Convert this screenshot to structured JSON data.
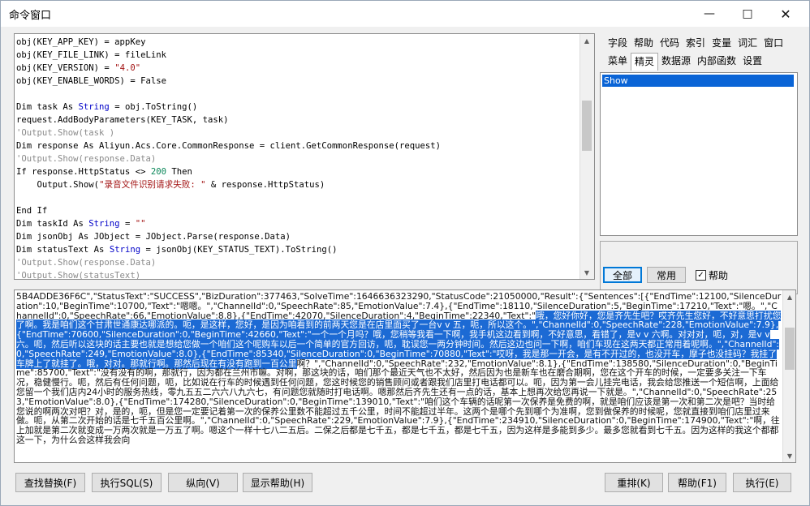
{
  "window": {
    "title": "命令窗口",
    "minimize_icon": "minimize-icon",
    "maximize_icon": "maximize-icon",
    "close_icon": "close-icon"
  },
  "code": {
    "lines": [
      [
        {
          "t": "obj(KEY_APP_KEY) = appKey"
        }
      ],
      [
        {
          "t": "obj(KEY_FILE_LINK) = fileLink"
        }
      ],
      [
        {
          "t": "obj(KEY_VERSION) = "
        },
        {
          "t": "\"4.0\"",
          "c": "str"
        }
      ],
      [
        {
          "t": "obj(KEY_ENABLE_WORDS) = False"
        }
      ],
      [
        {
          "t": ""
        }
      ],
      [
        {
          "t": "Dim task As ",
          "c": ""
        },
        {
          "t": "String",
          "c": "kw"
        },
        {
          "t": " = obj.ToString()"
        }
      ],
      [
        {
          "t": "request.AddBodyParameters(KEY_TASK, task)"
        }
      ],
      [
        {
          "t": "'Output.Show(task )",
          "c": "cm"
        }
      ],
      [
        {
          "t": "Dim response As Aliyun.Acs.Core.CommonResponse = client.GetCommonResponse(request)"
        }
      ],
      [
        {
          "t": "'Output.Show(response.Data)",
          "c": "cm"
        }
      ],
      [
        {
          "t": "If response.HttpStatus <> "
        },
        {
          "t": "200",
          "c": "num"
        },
        {
          "t": " Then"
        }
      ],
      [
        {
          "t": "    Output.Show("
        },
        {
          "t": "\"录音文件识别请求失败: \"",
          "c": "str"
        },
        {
          "t": " & response.HttpStatus)"
        }
      ],
      [
        {
          "t": ""
        }
      ],
      [
        {
          "t": "End If"
        }
      ],
      [
        {
          "t": "Dim taskId As "
        },
        {
          "t": "String",
          "c": "kw"
        },
        {
          "t": " = "
        },
        {
          "t": "\"\"",
          "c": "str"
        }
      ],
      [
        {
          "t": "Dim jsonObj As JObject = JObject.Parse(response.Data)"
        }
      ],
      [
        {
          "t": "Dim statusText As "
        },
        {
          "t": "String",
          "c": "kw"
        },
        {
          "t": " = jsonObj(KEY_STATUS_TEXT).ToString()"
        }
      ],
      [
        {
          "t": "'Output.Show(response.Data)",
          "c": "cm"
        }
      ],
      [
        {
          "t": "'Output.Show(statusText)",
          "c": "cm"
        }
      ]
    ]
  },
  "panel": {
    "tabs_row1": [
      "字段",
      "帮助",
      "代码",
      "索引",
      "变量",
      "词汇",
      "窗口"
    ],
    "tabs_row2": [
      "菜单",
      "精灵",
      "数据源",
      "内部函数",
      "设置"
    ],
    "active_tab": "精灵",
    "list_items": [
      "Show"
    ],
    "filter_all": "全部",
    "filter_common": "常用",
    "help_checkbox": "帮助",
    "help_checked": true
  },
  "output": {
    "segments": [
      {
        "t": "5B4ADDE36F6C\",\"StatusText\":\"SUCCESS\",\"BizDuration\":377463,\"SolveTime\":1646636323290,\"StatusCode\":21050000,\"Result\":{\"Sentences\":[{\"EndTime\":12100,\"SilenceDuration\":10,\"BeginTime\":10700,\"Text\":\"嗯嗯。\",\"ChannelId\":0,\"SpeechRate\":85,\"EmotionValue\":7.4},{\"EndTime\":18110,\"SilenceDuration\":5,\"BeginTime\":17210,\"Text\":\"嗯。\",\"ChannelId\":0,\"SpeechRate\":66,\"EmotionValue\":8.8},{\"EndTime\":42070,\"SilenceDuration\":4,\"BeginTime\":22340,\"Text\":\""
      },
      {
        "t": "哦，您好你好，您是齐先生吧？哎齐先生您好，不好意思打扰您了啊。我是咱们这个甘肃世通康达哪派的。呃，是这样，您好，是因为咱看到的前两天您是在店里面买了一台v v 五，呃，所以这个。\",\"ChannelId\":0,\"SpeechRate\":228,\"EmotionValue\":7.9},{\"EndTime\":70600,\"SilenceDuration\":0,\"BeginTime\":42660,\"Text\":\"一个一个月吗？哦，您稍等我看一下啊，我手机这边看到啊，不好意思，看错了，是v v 六啊。对对对，呃，对，是v v 六。呃，然后听以这块的话主要也就是想给您做一个咱们这个呢购车以后一个简单的官方回访，呃，耽误您一两分钟时间。然后这边也问一下啊，咱们车现在这两天都正常用着呢啊。\",\"ChannelId\":0,\"SpeechRate\":249,\"EmotionValue\":8.0},{\"EndTime\":85340,\"SilenceDuration\":0,\"BeginTime\":70880,\"Text\":\"哎呀，我是那一开会，是有不开过的，也没开车，摩子也没挂码？我挂了车牌上了就挂了。哦，对对。那就行啊。那然后现在有没有跑到一百公里",
        "hl": true
      },
      {
        "t": "啊？\",\"ChannelId\":0,\"SpeechRate\":232,\"EmotionValue\":8.1},{\"EndTime\":138580,\"SilenceDuration\":0,\"BeginTime\":85700,\"Text\":\"没有没有的啊，那就行，因为都在兰州市嘛。对啊，那这块的话，咱们那个最近天气也不太好，然后因为也是新车也在磨合期啊，您在这个开车的时候，一定要多关注一下车况，稳健慢行。呃，然后有任何问题，呃，比如说在行车的时候遇到任何问题，您这时候您的销售顾问或者跟我们店里打电话都可以。呃，因为第一会儿挂完电话，我会给您推送一个短信啊，上面给您留一个我们店内24小时的服务热线，零九五五二六六八九六七，有问题您就随时打电话啊。嗯那然后齐先生还有一点的话，基本上想再次给您再说一下就是。\",\"ChannelId\":0,\"SpeechRate\":253,\"EmotionValue\":8.0},{\"EndTime\":174280,\"SilenceDuration\":0,\"BeginTime\":139010,\"Text\":\"咱们这个车辆的话呢第一次保养是免费的啊，就是咱们应该是第一次和第二次是吧？当时给您说的啊两次对吧？对，是的，呃，但是您一定要记着第一次的保养公里数不能超过五千公里，时间不能超过半年。这两个是哪个先到哪个为准啊，您到做保养的时候呢，您就直接到咱们店里过来做。呃，从第二次开始的话是七千五百公里啊。\",\"ChannelId\":0,\"SpeechRate\":229,\"EmotionValue\":7.9},{\"EndTime\":234910,\"SilenceDuration\":0,\"BeginTime\":174900,\"Text\":\"啊，往上加就是第二次就变成一万两次就是一万五了啊。嗯这个一样十七八二五后。二保之后都是七千五，都是七千五，都是七千五，因为这样是多能到多少。最多您就看到七千五。因为这样的我这个都都这一下，为什么会这样我会向"
      }
    ]
  },
  "buttons": {
    "find_replace": "查找替换(F)",
    "exec_sql": "执行SQL(S)",
    "vertical": "纵向(V)",
    "show_help": "显示帮助(H)",
    "reset": "重排(K)",
    "help": "帮助(F1)",
    "execute": "执行(E)"
  }
}
